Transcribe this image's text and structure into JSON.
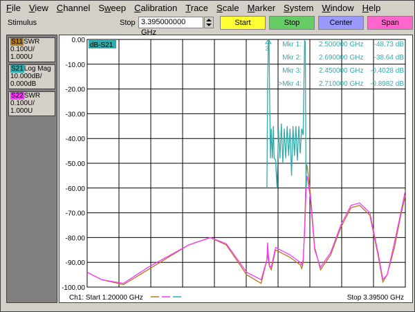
{
  "menu": [
    "File",
    "View",
    "Channel",
    "Sweep",
    "Calibration",
    "Trace",
    "Scale",
    "Marker",
    "System",
    "Window",
    "Help"
  ],
  "menu_underline": [
    0,
    0,
    0,
    1,
    0,
    0,
    0,
    0,
    0,
    0,
    0
  ],
  "toolbar": {
    "stimulus_label": "Stimulus",
    "stop_label": "Stop",
    "stop_value": "3.395000000 GHz",
    "start_button": "Start",
    "stop_button": "Stop",
    "center_button": "Center",
    "span_button": "Span"
  },
  "traces": [
    {
      "id": "S11",
      "format": "SWR",
      "scale": "0.100U/",
      "ref": "1.000U",
      "color": "#b07a1c"
    },
    {
      "id": "S21",
      "format": "Log Mag",
      "scale": "10.000dB/",
      "ref": "0.000dB",
      "color": "#33aaaa"
    },
    {
      "id": "S22",
      "format": "SWR",
      "scale": "0.100U/",
      "ref": "1.000U",
      "color": "#ff33ff"
    }
  ],
  "chart_data": {
    "type": "line",
    "active_trace_label": "dB-S21",
    "y_tick_labels": [
      "0.00",
      "-10.00",
      "-20.00",
      "-30.00",
      "-40.00",
      "-50.00",
      "-60.00",
      "-70.00",
      "-80.00",
      "-90.00",
      "-100.00"
    ],
    "ylim": [
      -100,
      0
    ],
    "xlim_ghz": [
      1.2,
      3.395
    ],
    "x_divisions": 10,
    "grid": true,
    "footer_start": "Ch1: Start  1.20000 GHz",
    "footer_stop": "Stop  3.39500 GHz",
    "markers": [
      {
        "label": "Mkr 1:",
        "freq": "2.500000 GHz",
        "value": "-48.73 dB"
      },
      {
        "label": "Mkr 2:",
        "freq": "2.690000 GHz",
        "value": "-38.64 dB"
      },
      {
        "label": "Mkr 3:",
        "freq": "2.450000 GHz",
        "value": "-0.4028 dB"
      },
      {
        "label": ">Mkr 4:",
        "freq": "2.710000 GHz",
        "value": "-0.8982 dB"
      }
    ],
    "marker3_flag": "3",
    "series": [
      {
        "name": "S11",
        "color": "#b07a1c",
        "x": [
          1.2,
          1.3,
          1.45,
          1.62,
          1.9,
          2.05,
          2.16,
          2.3,
          2.4,
          2.44,
          2.445,
          2.45,
          2.455,
          2.46,
          2.47,
          2.5,
          2.6,
          2.67,
          2.68,
          2.69,
          2.7,
          2.71,
          2.715,
          2.72,
          2.74,
          2.77,
          2.81,
          2.88,
          2.95,
          3.02,
          3.08,
          3.15,
          3.21,
          3.24,
          3.27,
          3.32,
          3.36,
          3.395
        ],
        "y": [
          -94,
          -97,
          -99,
          -93,
          -83,
          -80,
          -83,
          -95,
          -98.5,
          -89,
          -86,
          -89,
          -91,
          -92,
          -93,
          -85,
          -88,
          -91,
          -92.5,
          -90,
          -76,
          -56,
          -50.5,
          -52,
          -62,
          -84,
          -93,
          -87,
          -76,
          -68,
          -67,
          -71,
          -88,
          -98,
          -95,
          -84,
          -72,
          -63
        ]
      },
      {
        "name": "S22",
        "color": "#ff33ff",
        "x": [
          1.2,
          1.3,
          1.45,
          1.62,
          1.9,
          2.05,
          2.16,
          2.3,
          2.4,
          2.44,
          2.445,
          2.45,
          2.455,
          2.46,
          2.47,
          2.5,
          2.6,
          2.67,
          2.68,
          2.69,
          2.7,
          2.71,
          2.715,
          2.72,
          2.74,
          2.77,
          2.81,
          2.88,
          2.95,
          3.02,
          3.08,
          3.15,
          3.21,
          3.24,
          3.27,
          3.32,
          3.36,
          3.395
        ],
        "y": [
          -94,
          -97,
          -98.5,
          -92,
          -83,
          -80,
          -82.5,
          -94,
          -97,
          -89,
          -82,
          -87,
          -90,
          -91.5,
          -92,
          -84,
          -87,
          -90,
          -91,
          -89,
          -78,
          -62,
          -55,
          -56,
          -64,
          -85,
          -92,
          -86,
          -75,
          -67,
          -66,
          -70,
          -87,
          -97,
          -95,
          -82,
          -71,
          -61
        ]
      },
      {
        "name": "S21",
        "color": "#33aaaa",
        "x": [
          2.44,
          2.445,
          2.45,
          2.455,
          2.46,
          2.465,
          2.47,
          2.478,
          2.485,
          2.49,
          2.5,
          2.51,
          2.52,
          2.53,
          2.54,
          2.55,
          2.56,
          2.57,
          2.58,
          2.59,
          2.6,
          2.61,
          2.62,
          2.63,
          2.64,
          2.65,
          2.66,
          2.67,
          2.68,
          2.69,
          2.7,
          2.705,
          2.71
        ],
        "y": [
          -60,
          -20,
          -0.4,
          -0.3,
          -30,
          -48,
          -36,
          -48,
          -35,
          -48,
          -48.7,
          -60,
          -36,
          -48,
          -34,
          -50,
          -36,
          -48,
          -35,
          -47,
          -36,
          -55,
          -35,
          -47,
          -35,
          -49,
          -35,
          -46,
          -36,
          -38.6,
          -0.5,
          -0.9,
          -60
        ]
      }
    ]
  }
}
